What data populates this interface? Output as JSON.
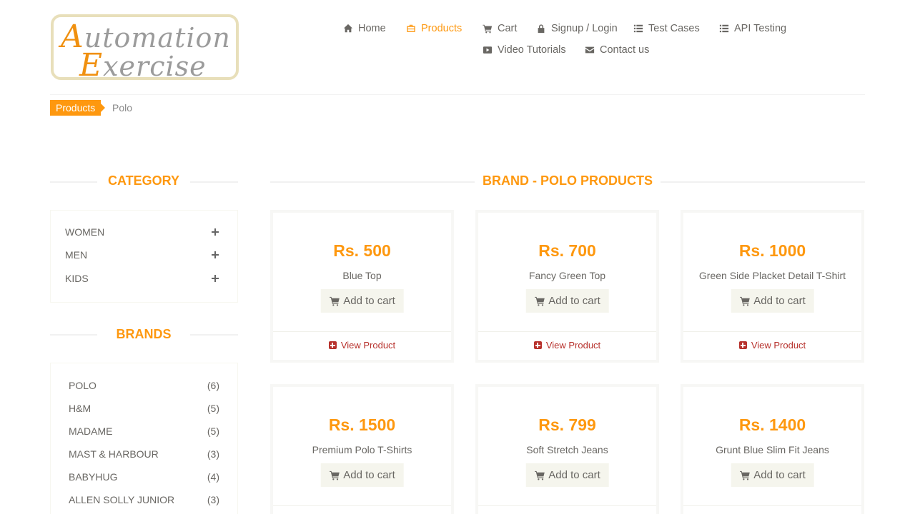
{
  "logo": {
    "line1_cap": "A",
    "line1_rest": "utomation",
    "line2_cap": "E",
    "line2_rest": "xercise"
  },
  "nav": {
    "items": [
      {
        "label": "Home",
        "icon": "home-icon"
      },
      {
        "label": "Products",
        "icon": "briefcase-icon",
        "active": true
      },
      {
        "label": "Cart",
        "icon": "cart-icon"
      },
      {
        "label": "Signup / Login",
        "icon": "lock-icon"
      },
      {
        "label": "Test Cases",
        "icon": "list-icon"
      },
      {
        "label": "API Testing",
        "icon": "list-icon"
      },
      {
        "label": "Video Tutorials",
        "icon": "youtube-icon"
      },
      {
        "label": "Contact us",
        "icon": "envelope-icon"
      }
    ]
  },
  "breadcrumb": {
    "parent": "Products",
    "current": "Polo"
  },
  "sidebar": {
    "category_title": "Category",
    "categories": [
      "WOMEN",
      "MEN",
      "KIDS"
    ],
    "brands_title": "Brands",
    "brands": [
      {
        "name": "POLO",
        "count": "(6)"
      },
      {
        "name": "H&M",
        "count": "(5)"
      },
      {
        "name": "MADAME",
        "count": "(5)"
      },
      {
        "name": "MAST & HARBOUR",
        "count": "(3)"
      },
      {
        "name": "BABYHUG",
        "count": "(4)"
      },
      {
        "name": "ALLEN SOLLY JUNIOR",
        "count": "(3)"
      }
    ]
  },
  "main": {
    "title": "Brand - Polo Products",
    "add_to_cart_label": "Add to cart",
    "view_product_label": "View Product",
    "products": [
      {
        "price": "Rs. 500",
        "name": "Blue Top"
      },
      {
        "price": "Rs. 700",
        "name": "Fancy Green Top"
      },
      {
        "price": "Rs. 1000",
        "name": "Green Side Placket Detail T-Shirt"
      },
      {
        "price": "Rs. 1500",
        "name": "Premium Polo T-Shirts"
      },
      {
        "price": "Rs. 799",
        "name": "Soft Stretch Jeans"
      },
      {
        "price": "Rs. 1400",
        "name": "Grunt Blue Slim Fit Jeans"
      }
    ]
  },
  "colors": {
    "accent": "#fe980f",
    "text": "#696763",
    "link": "#b7312c",
    "button_bg": "#f5f5ed"
  }
}
